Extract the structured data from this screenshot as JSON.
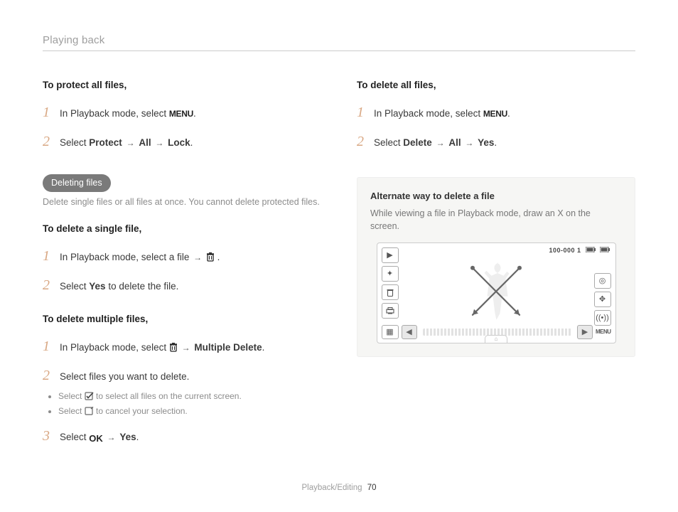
{
  "header": {
    "title": "Playing back"
  },
  "left": {
    "protect_all_head": "To protect all files,",
    "protect_all_steps": [
      {
        "n": "1",
        "pre": "In Playback mode, select ",
        "icon": "MENU",
        "post": "."
      },
      {
        "n": "2",
        "pre": "Select ",
        "b1": "Protect",
        "b2": "All",
        "b3": "Lock",
        "post": "."
      }
    ],
    "pill": "Deleting files",
    "pill_desc": "Delete single files or all files at once. You cannot delete protected files.",
    "single_head": "To delete a single file,",
    "single_steps": [
      {
        "n": "1",
        "pre": "In Playback mode, select a file ",
        "icon": "trash",
        "post": "."
      },
      {
        "n": "2",
        "pre": "Select ",
        "b1": "Yes",
        "post": " to delete the file."
      }
    ],
    "multi_head": "To delete multiple files,",
    "multi_steps": [
      {
        "n": "1",
        "pre": "In Playback mode, select ",
        "icon": "trash",
        "mid": " → ",
        "b1": "Multiple Delete",
        "post": "."
      },
      {
        "n": "2",
        "pre": "Select files you want to delete."
      },
      {
        "n": "3",
        "pre": "Select ",
        "icon": "OK",
        "mid": " → ",
        "b1": "Yes",
        "post": "."
      }
    ],
    "multi_bullets": [
      {
        "pre": "Select ",
        "icon": "check",
        "post": " to select all files on the current screen."
      },
      {
        "pre": "Select ",
        "icon": "square",
        "post": " to cancel your selection."
      }
    ]
  },
  "right": {
    "delete_all_head": "To delete all files,",
    "delete_all_steps": [
      {
        "n": "1",
        "pre": "In Playback mode, select ",
        "icon": "MENU",
        "post": "."
      },
      {
        "n": "2",
        "pre": "Select ",
        "b1": "Delete",
        "b2": "All",
        "b3": "Yes",
        "post": "."
      }
    ],
    "note": {
      "title": "Alternate way to delete a file",
      "body": "While viewing a file in Playback mode, draw an X on the screen."
    },
    "screen": {
      "status_code": "100-000 1",
      "menu_label": "MENU"
    }
  },
  "footer": {
    "section": "Playback/Editing",
    "page": "70"
  }
}
